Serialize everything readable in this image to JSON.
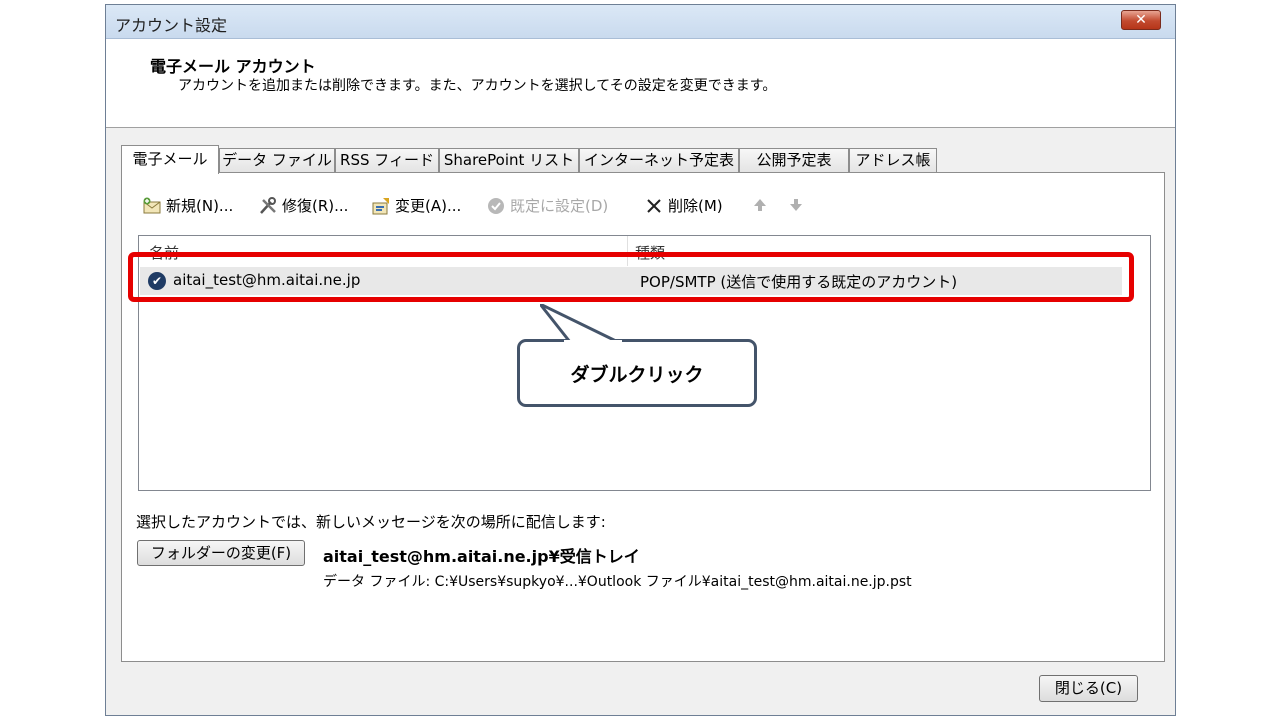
{
  "window": {
    "title": "アカウント設定",
    "close_glyph": "✕"
  },
  "header": {
    "title": "電子メール アカウント",
    "description": "アカウントを追加または削除できます。また、アカウントを選択してその設定を変更できます。"
  },
  "tabs": [
    {
      "label": "電子メール",
      "active": true
    },
    {
      "label": "データ ファイル"
    },
    {
      "label": "RSS フィード"
    },
    {
      "label": "SharePoint リスト"
    },
    {
      "label": "インターネット予定表"
    },
    {
      "label": "公開予定表"
    },
    {
      "label": "アドレス帳"
    }
  ],
  "toolbar": {
    "new_label": "新規(N)...",
    "repair_label": "修復(R)...",
    "change_label": "変更(A)...",
    "default_label": "既定に設定(D)",
    "delete_label": "削除(M)"
  },
  "list": {
    "col_name": "名前",
    "col_type": "種類",
    "rows": [
      {
        "name": "aitai_test@hm.aitai.ne.jp",
        "type": "POP/SMTP (送信で使用する既定のアカウント)"
      }
    ]
  },
  "callout": {
    "text": "ダブルクリック"
  },
  "delivery": {
    "label": "選択したアカウントでは、新しいメッセージを次の場所に配信します:",
    "folder_button": "フォルダーの変更(F)",
    "folder_path": "aitai_test@hm.aitai.ne.jp¥受信トレイ",
    "data_file": "データ ファイル: C:¥Users¥supkyo¥...¥Outlook ファイル¥aitai_test@hm.aitai.ne.jp.pst"
  },
  "footer": {
    "close_label": "閉じる(C)"
  },
  "colors": {
    "highlight": "#e60000",
    "callout_border": "#44546a"
  }
}
